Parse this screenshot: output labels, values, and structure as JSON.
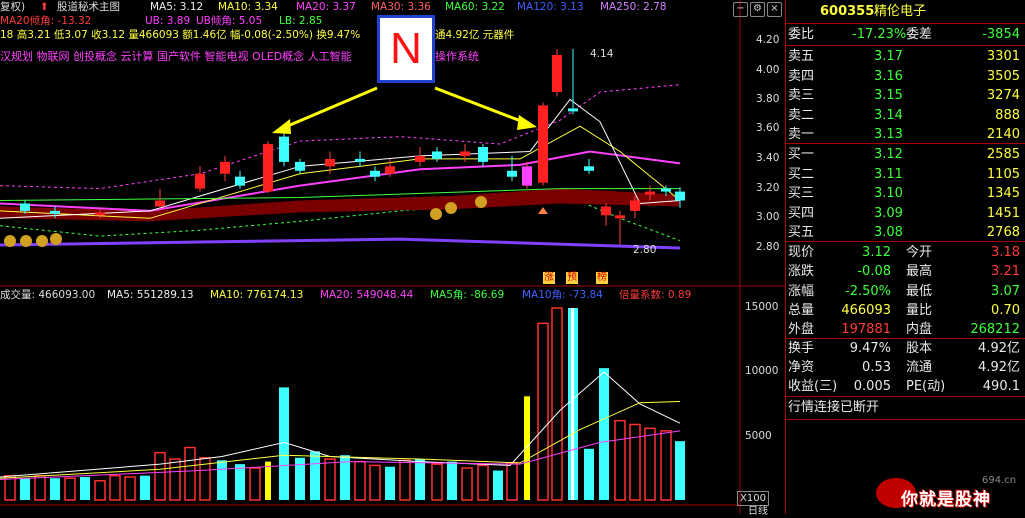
{
  "title_bar": {
    "mode_label": "复权)",
    "formula_name": "股道秘术主图",
    "ma5": "MA5: 3.12",
    "ma10": "MA10: 3.34",
    "ma20": "MA20: 3.37",
    "ma30": "MA30: 3.36",
    "ma60": "MA60: 3.22",
    "ma120": "MA120: 3.13",
    "ma250": "MA250: 2.78"
  },
  "line2": {
    "ma20_angle": "MA20倾角: -13.32",
    "ub": "UB: 3.89",
    "ub_angle": "UB倾角: 5.05",
    "lb": "LB: 2.85"
  },
  "line3": {
    "ohlc": "18 高3.21 低3.07 收3.12 量466093 额1.46亿 幅-0.08(-2.50%) 换9.47%",
    "circ": "通4.92亿 元器件"
  },
  "line4": {
    "concepts": "汉规划 物联网 创投概念 云计算 国产软件 智能电视 OLED概念 人工智能",
    "concepts_tail": "操作系统"
  },
  "annotation": {
    "letter": "N"
  },
  "price_labels": {
    "high": "4.14",
    "low": "2.80"
  },
  "y_axis_price": [
    "4.20",
    "4.00",
    "3.80",
    "3.60",
    "3.40",
    "3.20",
    "3.00",
    "2.80"
  ],
  "volume_bar": {
    "vol": "成交量: 466093.00",
    "ma5": "MA5: 551289.13",
    "ma10": "MA10: 776174.13",
    "ma20": "MA20: 549048.44",
    "ma5_angle": "MA5角: -86.69",
    "ma10_angle": "MA10角: -73.84",
    "multiplier": "倍量系数: 0.89"
  },
  "y_axis_volume": [
    "15000",
    "10000",
    "5000"
  ],
  "x100_label": "X100",
  "signals": [
    "涨",
    "预",
    "榜"
  ],
  "quote": {
    "code": "600355",
    "name": "精伦电子",
    "webi_label": "委比",
    "webi_value": "-17.23%",
    "weicha_label": "委差",
    "weicha_value": "-3854",
    "asks": [
      {
        "label": "卖五",
        "price": "3.17",
        "vol": "3301"
      },
      {
        "label": "卖四",
        "price": "3.16",
        "vol": "3505"
      },
      {
        "label": "卖三",
        "price": "3.15",
        "vol": "3274"
      },
      {
        "label": "卖二",
        "price": "3.14",
        "vol": "888"
      },
      {
        "label": "卖一",
        "price": "3.13",
        "vol": "2140"
      }
    ],
    "bids": [
      {
        "label": "买一",
        "price": "3.12",
        "vol": "2585"
      },
      {
        "label": "买二",
        "price": "3.11",
        "vol": "1105"
      },
      {
        "label": "买三",
        "price": "3.10",
        "vol": "1345"
      },
      {
        "label": "买四",
        "price": "3.09",
        "vol": "1451"
      },
      {
        "label": "买五",
        "price": "3.08",
        "vol": "2768"
      }
    ],
    "stats": [
      {
        "l1": "现价",
        "v1": "3.12",
        "l2": "今开",
        "v2": "3.18"
      },
      {
        "l1": "涨跌",
        "v1": "-0.08",
        "l2": "最高",
        "v2": "3.21"
      },
      {
        "l1": "涨幅",
        "v1": "-2.50%",
        "l2": "最低",
        "v2": "3.07"
      },
      {
        "l1": "总量",
        "v1": "466093",
        "l2": "量比",
        "v2": "0.70"
      },
      {
        "l1": "外盘",
        "v1": "197881",
        "l2": "内盘",
        "v2": "268212"
      }
    ],
    "stats2": [
      {
        "l1": "换手",
        "v1": "9.47%",
        "l2": "股本",
        "v2": "4.92亿"
      },
      {
        "l1": "净资",
        "v1": "0.53",
        "l2": "流通",
        "v2": "4.92亿"
      },
      {
        "l1": "收益(三)",
        "v1": "0.005",
        "l2": "PE(动)",
        "v2": "490.1"
      }
    ],
    "status": "行情连接已断开"
  },
  "watermark": {
    "site": "694.cn",
    "text": "你就是股神"
  },
  "bottom_label": "日线",
  "colors": {
    "up": "#ff3c3c",
    "down": "#3cffff",
    "bg": "#000000",
    "grid": "#a00000"
  }
}
